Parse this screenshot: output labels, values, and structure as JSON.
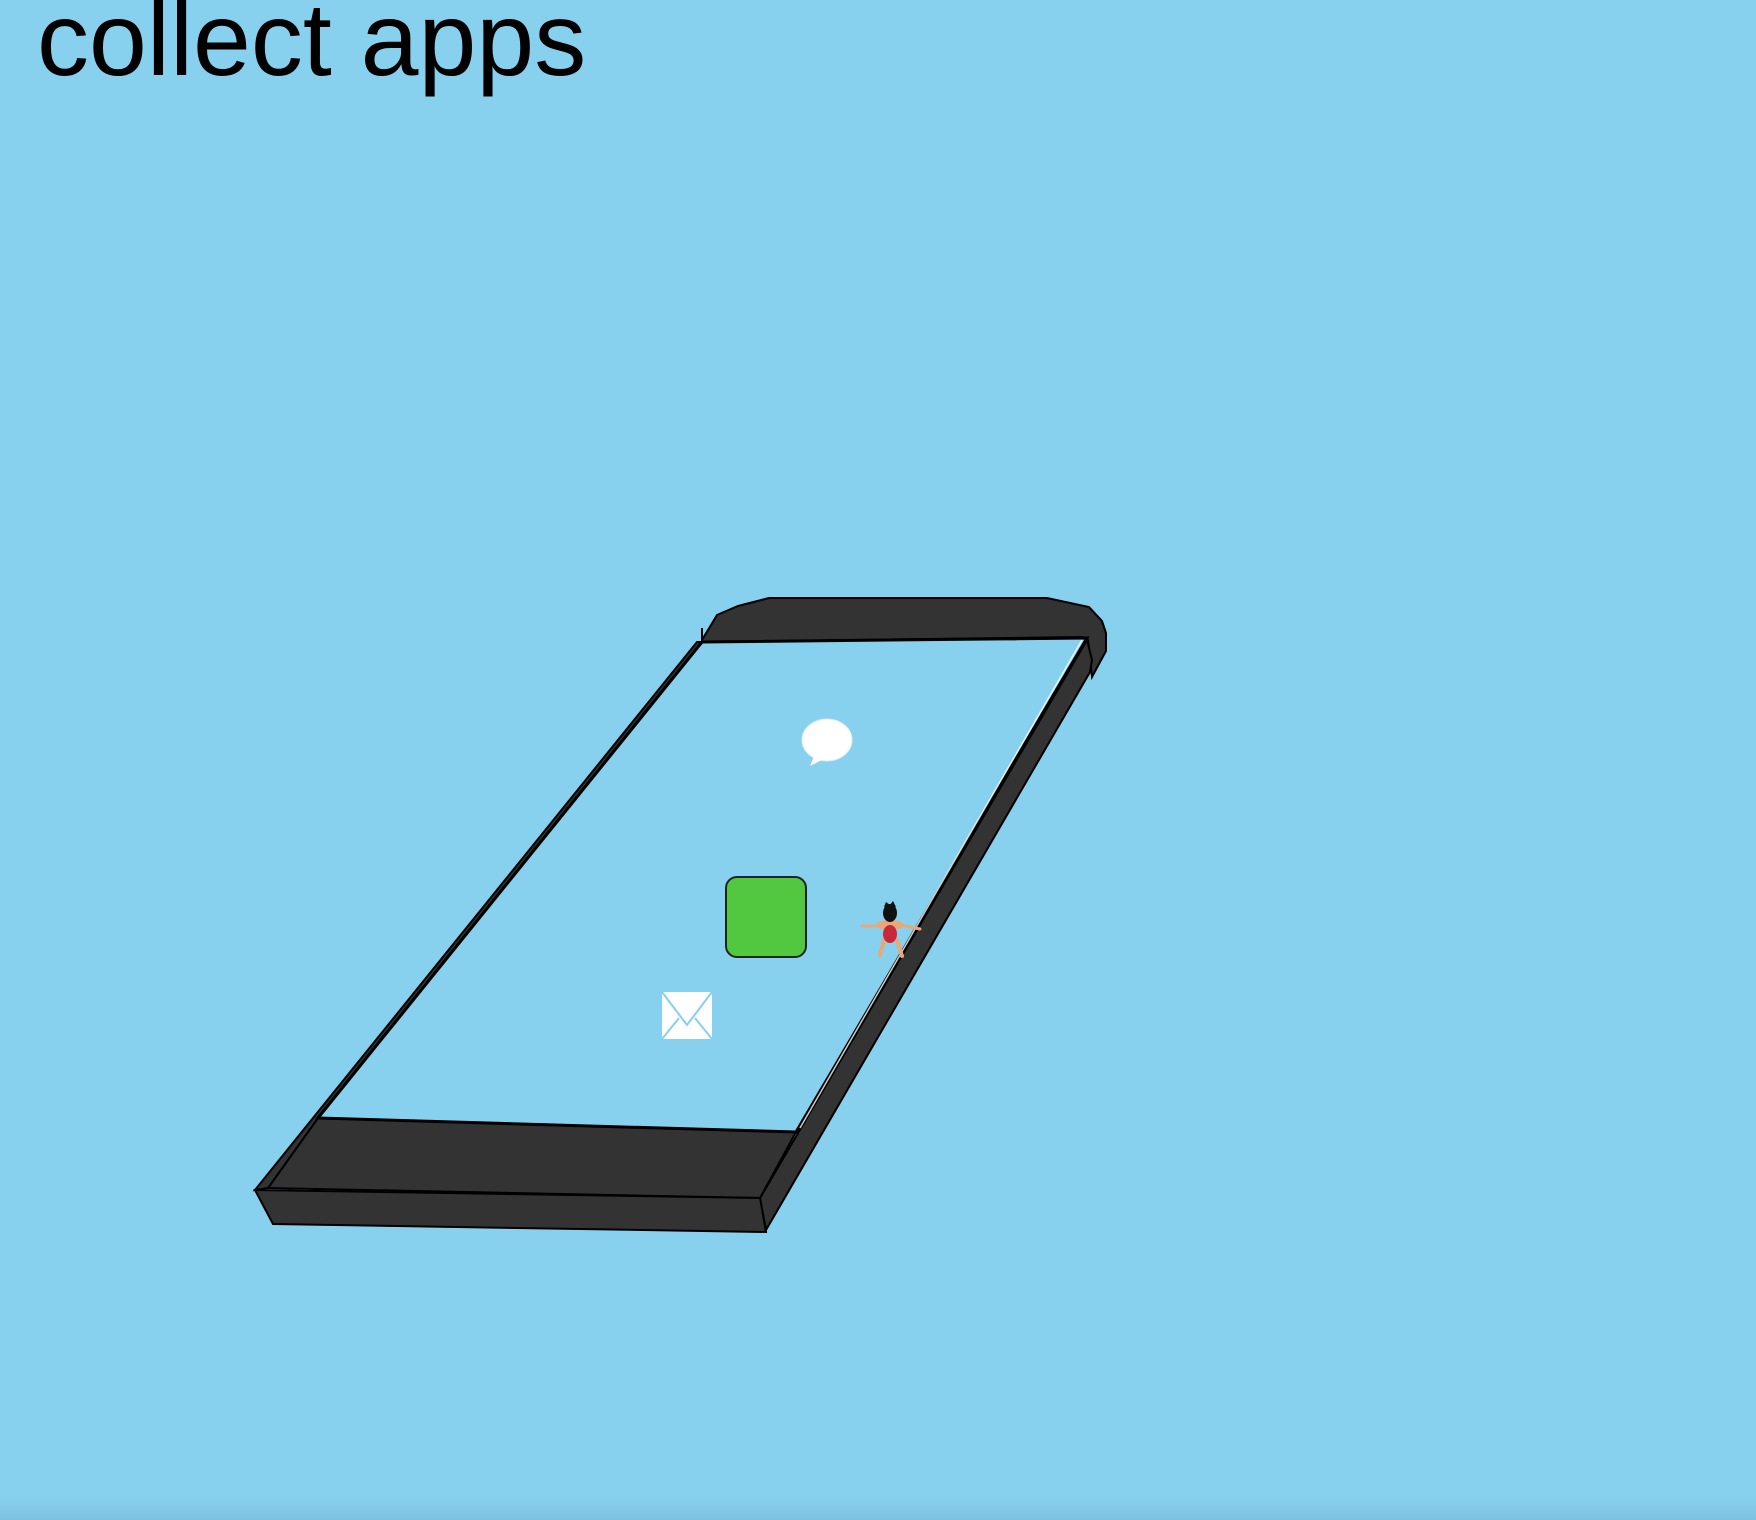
{
  "game": {
    "title": "collect apps"
  },
  "colors": {
    "sky": "#87d0ee",
    "phone_body": "#333333",
    "phone_screen": "#87d0ee",
    "app_green": "#52c841",
    "outline": "#000000"
  },
  "items": [
    {
      "name": "speech-bubble-icon",
      "kind": "message app"
    },
    {
      "name": "green-app-icon",
      "kind": "app"
    },
    {
      "name": "envelope-icon",
      "kind": "mail app"
    }
  ],
  "player": {
    "name": "player-character"
  }
}
